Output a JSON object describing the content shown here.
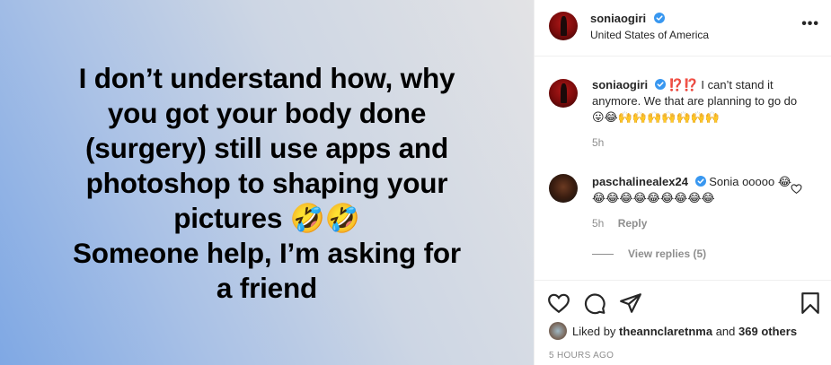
{
  "post": {
    "lines": [
      "I don’t understand how, why",
      "you got your body done",
      "(surgery) still use apps and",
      "photoshop to shaping your",
      "pictures 🤣🤣",
      "Someone help, I’m asking for",
      "a friend"
    ]
  },
  "header": {
    "username": "soniaogiri",
    "location": "United States of America",
    "more_icon": "more-horizontal-icon"
  },
  "caption": {
    "username": "soniaogiri",
    "text": "⁉️⁉️ I can’t stand it anymore. We that are planning to go do 😛😂🙌🙌🙌🙌🙌🙌🙌",
    "time": "5h"
  },
  "comment": {
    "username": "paschalinealex24",
    "text": "Sonia ooooo 😂😂😂😂😂😂😂😂😂😂",
    "time": "5h",
    "reply_label": "Reply"
  },
  "view_replies": "View replies (5)",
  "likes": {
    "prefix": "Liked by ",
    "liker": "theannclaretnma",
    "middle": " and ",
    "others": "369 others"
  },
  "time_ago": "5 HOURS AGO",
  "colors": {
    "verified": "#3897f0",
    "text": "#262626",
    "muted": "#8e8e8e"
  }
}
